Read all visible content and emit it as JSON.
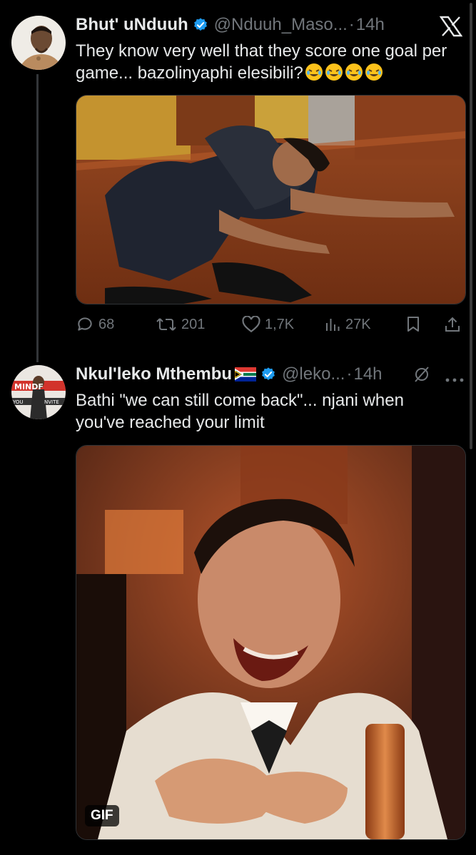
{
  "tweets": [
    {
      "author_name": "Bhut' uNduuh",
      "handle": "@Nduuh_Maso...",
      "dot": "·",
      "time": "14h",
      "text": "They know very well that they score one goal per game... bazolinyaphi elesibili?",
      "emoji_count": 4,
      "stats": {
        "replies": "68",
        "reposts": "201",
        "likes": "1,7K",
        "views": "27K"
      }
    },
    {
      "author_name": "Nkul'leko Mthembu",
      "flag_emoji": "south-africa-flag",
      "handle": "@leko...",
      "dot": "·",
      "time": "14h",
      "text": "Bathi \"we can still come back\"... njani when you've reached your limit",
      "media_badge": "GIF",
      "avatar_text": {
        "top": "MINDF",
        "left": "YOU",
        "right": "NVITE"
      }
    }
  ],
  "colors": {
    "background": "#000000",
    "text": "#e7e9ea",
    "muted": "#71767b",
    "verified": "#1d9bf0",
    "thread_line": "#333639"
  }
}
